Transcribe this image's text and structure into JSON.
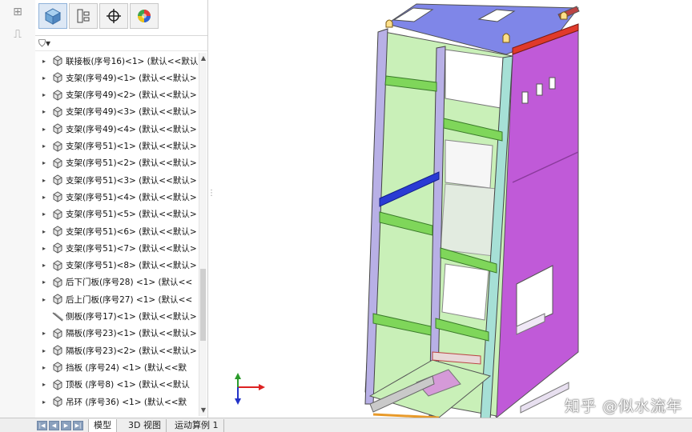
{
  "tree": {
    "items": [
      {
        "label": "联接板(序号16)<1> (默认<<默认",
        "expanded": false
      },
      {
        "label": "支架(序号49)<1> (默认<<默认>",
        "expanded": false
      },
      {
        "label": "支架(序号49)<2> (默认<<默认>",
        "expanded": false
      },
      {
        "label": "支架(序号49)<3> (默认<<默认>",
        "expanded": false
      },
      {
        "label": "支架(序号49)<4> (默认<<默认>",
        "expanded": false
      },
      {
        "label": "支架(序号51)<1> (默认<<默认>",
        "expanded": false
      },
      {
        "label": "支架(序号51)<2> (默认<<默认>",
        "expanded": false
      },
      {
        "label": "支架(序号51)<3> (默认<<默认>",
        "expanded": false
      },
      {
        "label": "支架(序号51)<4> (默认<<默认>",
        "expanded": false
      },
      {
        "label": "支架(序号51)<5> (默认<<默认>",
        "expanded": false
      },
      {
        "label": "支架(序号51)<6> (默认<<默认>",
        "expanded": false
      },
      {
        "label": "支架(序号51)<7> (默认<<默认>",
        "expanded": false
      },
      {
        "label": "支架(序号51)<8> (默认<<默认>",
        "expanded": false
      },
      {
        "label": "后下门板(序号28)  <1> (默认<<",
        "expanded": false
      },
      {
        "label": "后上门板(序号27)  <1> (默认<<",
        "expanded": false
      },
      {
        "label": "侧板(序号17)<1> (默认<<默认>",
        "expanded": null
      },
      {
        "label": "隔板(序号23)<1> (默认<<默认>",
        "expanded": false
      },
      {
        "label": "隔板(序号23)<2> (默认<<默认>",
        "expanded": false
      },
      {
        "label": "挡板 (序号24)  <1> (默认<<默",
        "expanded": false
      },
      {
        "label": "顶板 (序号8)  <1> (默认<<默认",
        "expanded": false
      },
      {
        "label": "吊环 (序号36)  <1> (默认<<默",
        "expanded": false
      }
    ]
  },
  "bottom_tabs": [
    "模型",
    "3D 视图",
    "运动算例 1"
  ],
  "watermark": "知乎 @似水流年",
  "icons": {
    "fm_tabs": [
      "feature-manager-icon",
      "property-manager-icon",
      "configuration-manager-icon",
      "appearance-icon"
    ],
    "filter": "filter-icon"
  },
  "colors": {
    "frame_post": "#b8b0e6",
    "beam": "#7fd65a",
    "side_panel": "#c05ad8",
    "back_panel": "#c9f0b8",
    "top": "#7f86e8",
    "lifting_rail": "#e03a2a",
    "diagonal": "#2a3bd4"
  }
}
